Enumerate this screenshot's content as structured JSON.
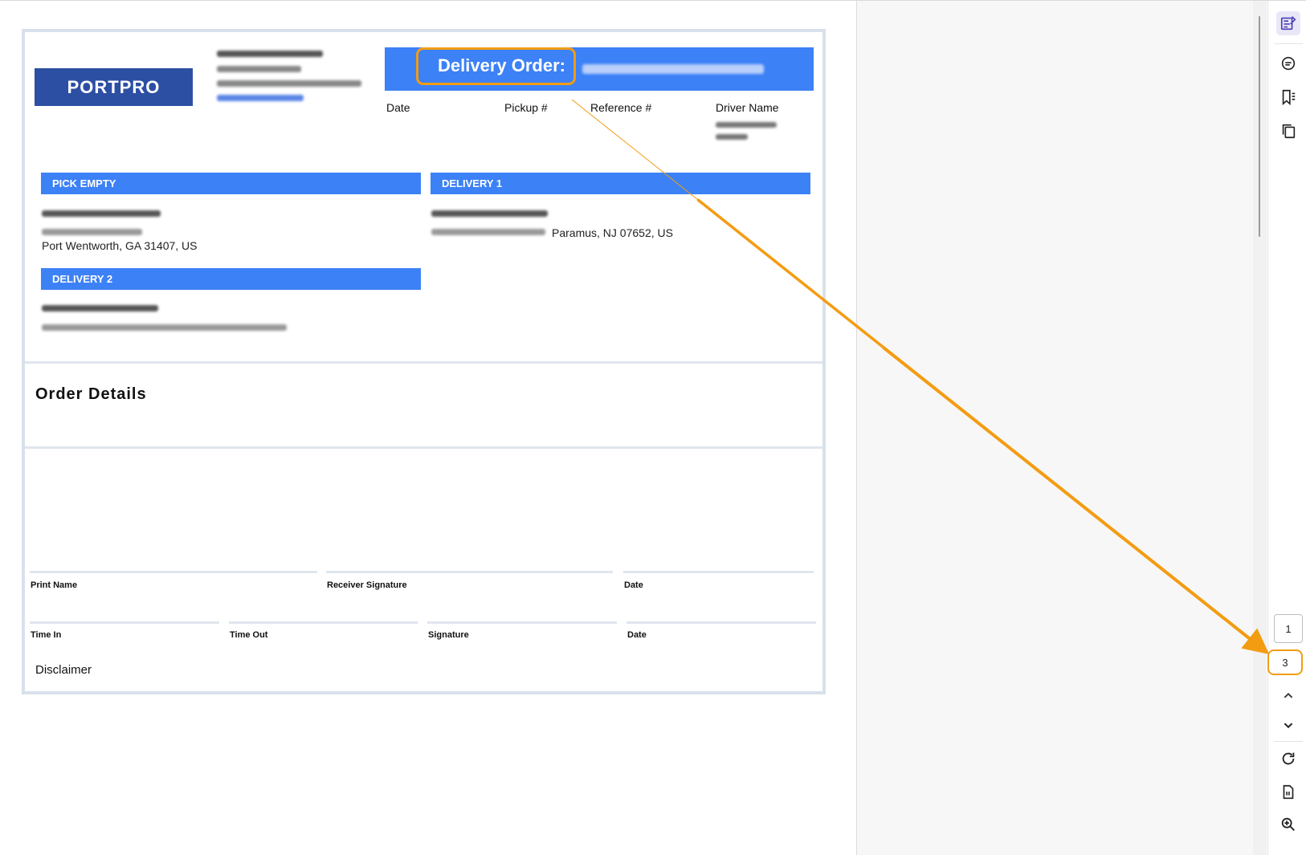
{
  "document": {
    "logo_text": "PORTPRO",
    "header_title": "Delivery Order:",
    "columns": [
      "Date",
      "Pickup #",
      "Reference #",
      "Driver Name"
    ],
    "sections": {
      "pick_empty": {
        "title": "PICK EMPTY",
        "city_line": "Port Wentworth, GA 31407, US"
      },
      "delivery1": {
        "title": "DELIVERY 1",
        "city_line": "Paramus, NJ 07652, US"
      },
      "delivery2": {
        "title": "DELIVERY 2"
      }
    },
    "order_details_title": "Order Details",
    "signature_labels": {
      "print_name": "Print Name",
      "receiver_signature": "Receiver Signature",
      "date1": "Date",
      "time_in": "Time In",
      "time_out": "Time Out",
      "signature": "Signature",
      "date2": "Date"
    },
    "disclaimer": "Disclaimer"
  },
  "pager": {
    "page1": "1",
    "page_current": "3"
  },
  "toolbar_icons": [
    "edit-annotate-icon",
    "comment-icon",
    "bookmark-list-icon",
    "copy-pages-icon",
    "page-up-icon",
    "page-down-icon",
    "rotate-icon",
    "fit-page-icon",
    "zoom-in-icon"
  ],
  "colors": {
    "accent_blue": "#3c81f6",
    "logo_blue": "#2c4fa3",
    "highlight_orange": "#f39c12"
  }
}
